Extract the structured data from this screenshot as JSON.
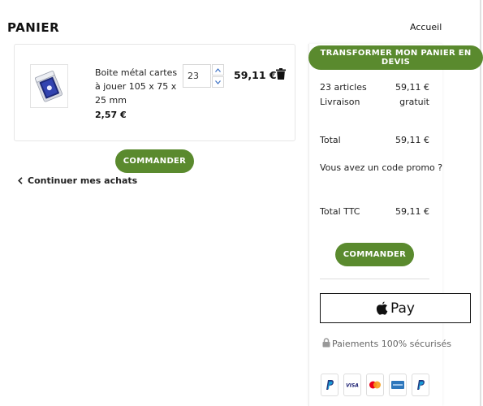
{
  "header": {
    "title": "PANIER",
    "home_link": "Accueil"
  },
  "cart": {
    "items": [
      {
        "name": "Boite métal cartes à jouer 105 x 75 x 25 mm",
        "unit_price": "2,57 €",
        "quantity": "23",
        "line_total": "59,11 €"
      }
    ],
    "order_button": "COMMANDER",
    "continue_link": "Continuer mes achats"
  },
  "summary": {
    "devis_button": "TRANSFORMER MON PANIER EN DEVIS",
    "articles_label": "23 articles",
    "articles_value": "59,11 €",
    "shipping_label": "Livraison",
    "shipping_value": "gratuit",
    "total_label": "Total",
    "total_value": "59,11 €",
    "promo_text": "Vous avez un code promo ?",
    "total_ttc_label": "Total TTC",
    "total_ttc_value": "59,11 €",
    "order_button": "COMMANDER",
    "apple_pay_label": "Pay",
    "secure_text": "Paiements 100% sécurisés",
    "payment_icons": [
      "paypal-icon",
      "visa-icon",
      "mastercard-icon",
      "amex-icon",
      "paypal-icon"
    ]
  },
  "colors": {
    "accent": "#5a8a2e",
    "paypal": "#253b80",
    "visa": "#1a1f71",
    "amex": "#2e77bc"
  }
}
